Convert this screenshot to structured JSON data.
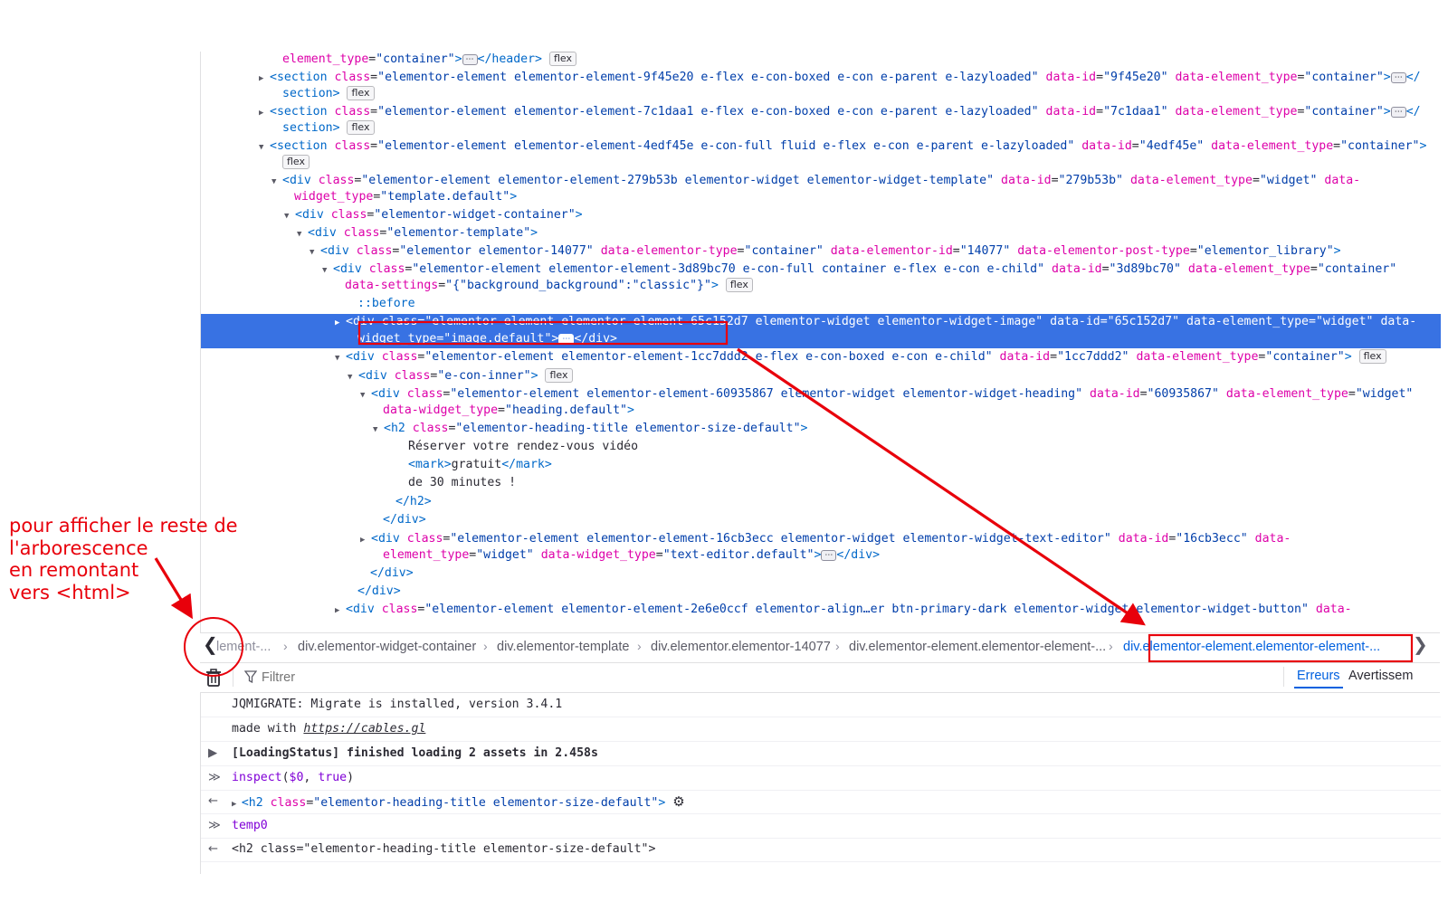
{
  "tree": [
    {
      "ind": 92,
      "tw": "",
      "parts": [
        [
          "an",
          "element_type"
        ],
        [
          "tx",
          "="
        ],
        [
          "av",
          "\"container\""
        ],
        [
          "tg",
          ">"
        ],
        [
          "dots",
          "⋯"
        ],
        [
          "tg",
          "</header>"
        ],
        [
          "sp",
          " "
        ],
        [
          "badge",
          "flex"
        ]
      ]
    },
    {
      "ind": 78,
      "tw": "▶",
      "parts": [
        [
          "tg",
          "<section "
        ],
        [
          "an",
          "class"
        ],
        [
          "tx",
          "="
        ],
        [
          "av",
          "\"elementor-element elementor-element-9f45e20 e-flex e-con-boxed e-con e-parent e-lazyloaded\""
        ],
        [
          "sp",
          " "
        ],
        [
          "an",
          "data-id"
        ],
        [
          "tx",
          "="
        ],
        [
          "av",
          "\"9f45e20\""
        ],
        [
          "sp",
          " "
        ],
        [
          "an",
          "data-element_type"
        ],
        [
          "tx",
          "="
        ],
        [
          "av",
          "\"container\""
        ],
        [
          "tg",
          ">"
        ],
        [
          "dots",
          "⋯"
        ],
        [
          "tg",
          "</"
        ]
      ]
    },
    {
      "ind": 92,
      "tw": "",
      "parts": [
        [
          "tg",
          "section>"
        ],
        [
          "sp",
          " "
        ],
        [
          "badge",
          "flex"
        ]
      ]
    },
    {
      "ind": 78,
      "tw": "▶",
      "parts": [
        [
          "tg",
          "<section "
        ],
        [
          "an",
          "class"
        ],
        [
          "tx",
          "="
        ],
        [
          "av",
          "\"elementor-element elementor-element-7c1daa1 e-flex e-con-boxed e-con e-parent e-lazyloaded\""
        ],
        [
          "sp",
          " "
        ],
        [
          "an",
          "data-id"
        ],
        [
          "tx",
          "="
        ],
        [
          "av",
          "\"7c1daa1\""
        ],
        [
          "sp",
          " "
        ],
        [
          "an",
          "data-element_type"
        ],
        [
          "tx",
          "="
        ],
        [
          "av",
          "\"container\""
        ],
        [
          "tg",
          ">"
        ],
        [
          "dots",
          "⋯"
        ],
        [
          "tg",
          "</"
        ]
      ]
    },
    {
      "ind": 92,
      "tw": "",
      "parts": [
        [
          "tg",
          "section>"
        ],
        [
          "sp",
          " "
        ],
        [
          "badge",
          "flex"
        ]
      ]
    },
    {
      "ind": 78,
      "tw": "▼",
      "parts": [
        [
          "tg",
          "<section "
        ],
        [
          "an",
          "class"
        ],
        [
          "tx",
          "="
        ],
        [
          "av",
          "\"elementor-element elementor-element-4edf45e e-con-full fluid e-flex e-con e-parent e-lazyloaded\""
        ],
        [
          "sp",
          " "
        ],
        [
          "an",
          "data-id"
        ],
        [
          "tx",
          "="
        ],
        [
          "av",
          "\"4edf45e\""
        ],
        [
          "sp",
          " "
        ],
        [
          "an",
          "data-element_type"
        ],
        [
          "tx",
          "="
        ],
        [
          "av",
          "\"container\""
        ],
        [
          "tg",
          ">"
        ]
      ]
    },
    {
      "ind": 92,
      "tw": "",
      "parts": [
        [
          "badge",
          "flex"
        ]
      ]
    },
    {
      "ind": 92,
      "tw": "▼",
      "parts": [
        [
          "tg",
          "<div "
        ],
        [
          "an",
          "class"
        ],
        [
          "tx",
          "="
        ],
        [
          "av",
          "\"elementor-element elementor-element-279b53b elementor-widget elementor-widget-template\""
        ],
        [
          "sp",
          " "
        ],
        [
          "an",
          "data-id"
        ],
        [
          "tx",
          "="
        ],
        [
          "av",
          "\"279b53b\""
        ],
        [
          "sp",
          " "
        ],
        [
          "an",
          "data-element_type"
        ],
        [
          "tx",
          "="
        ],
        [
          "av",
          "\"widget\""
        ],
        [
          "sp",
          " "
        ],
        [
          "an",
          "data-"
        ]
      ]
    },
    {
      "ind": 105,
      "tw": "",
      "parts": [
        [
          "an",
          "widget_type"
        ],
        [
          "tx",
          "="
        ],
        [
          "av",
          "\"template.default\""
        ],
        [
          "tg",
          ">"
        ]
      ]
    },
    {
      "ind": 106,
      "tw": "▼",
      "parts": [
        [
          "tg",
          "<div "
        ],
        [
          "an",
          "class"
        ],
        [
          "tx",
          "="
        ],
        [
          "av",
          "\"elementor-widget-container\""
        ],
        [
          "tg",
          ">"
        ]
      ]
    },
    {
      "ind": 120,
      "tw": "▼",
      "parts": [
        [
          "tg",
          "<div "
        ],
        [
          "an",
          "class"
        ],
        [
          "tx",
          "="
        ],
        [
          "av",
          "\"elementor-template\""
        ],
        [
          "tg",
          ">"
        ]
      ]
    },
    {
      "ind": 134,
      "tw": "▼",
      "parts": [
        [
          "tg",
          "<div "
        ],
        [
          "an",
          "class"
        ],
        [
          "tx",
          "="
        ],
        [
          "av",
          "\"elementor elementor-14077\""
        ],
        [
          "sp",
          " "
        ],
        [
          "an",
          "data-elementor-type"
        ],
        [
          "tx",
          "="
        ],
        [
          "av",
          "\"container\""
        ],
        [
          "sp",
          " "
        ],
        [
          "an",
          "data-elementor-id"
        ],
        [
          "tx",
          "="
        ],
        [
          "av",
          "\"14077\""
        ],
        [
          "sp",
          " "
        ],
        [
          "an",
          "data-elementor-post-type"
        ],
        [
          "tx",
          "="
        ],
        [
          "av",
          "\"elementor_library\""
        ],
        [
          "tg",
          ">"
        ]
      ]
    },
    {
      "ind": 148,
      "tw": "▼",
      "parts": [
        [
          "tg",
          "<div "
        ],
        [
          "an",
          "class"
        ],
        [
          "tx",
          "="
        ],
        [
          "av",
          "\"elementor-element elementor-element-3d89bc70 e-con-full container e-flex e-con e-child\""
        ],
        [
          "sp",
          " "
        ],
        [
          "an",
          "data-id"
        ],
        [
          "tx",
          "="
        ],
        [
          "av",
          "\"3d89bc70\""
        ],
        [
          "sp",
          " "
        ],
        [
          "an",
          "data-element_type"
        ],
        [
          "tx",
          "="
        ],
        [
          "av",
          "\"container\""
        ]
      ]
    },
    {
      "ind": 161,
      "tw": "",
      "parts": [
        [
          "an",
          "data-settings"
        ],
        [
          "tx",
          "="
        ],
        [
          "av",
          "\"{\"background_background\":\"classic\"}\""
        ],
        [
          "tg",
          ">"
        ],
        [
          "sp",
          " "
        ],
        [
          "badge",
          "flex"
        ]
      ]
    },
    {
      "ind": 175,
      "tw": "",
      "parts": [
        [
          "ps",
          "::before"
        ]
      ]
    },
    {
      "ind": 162,
      "tw": "▶",
      "sel": true,
      "parts": [
        [
          "tg",
          "<div "
        ],
        [
          "an",
          "class"
        ],
        [
          "tx",
          "="
        ],
        [
          "av",
          "\"elementor-element elementor-element-65c152d7 elementor-widget elementor-widget-image\""
        ],
        [
          "sp",
          " "
        ],
        [
          "an",
          "data-id"
        ],
        [
          "tx",
          "="
        ],
        [
          "av",
          "\"65c152d7\""
        ],
        [
          "sp",
          " "
        ],
        [
          "an",
          "data-element_type"
        ],
        [
          "tx",
          "="
        ],
        [
          "av",
          "\"widget\""
        ],
        [
          "sp",
          " "
        ],
        [
          "an",
          "data-"
        ]
      ]
    },
    {
      "ind": 175,
      "tw": "",
      "sel": true,
      "parts": [
        [
          "an",
          "widget_type"
        ],
        [
          "tx",
          "="
        ],
        [
          "av",
          "\"image.default\""
        ],
        [
          "tg",
          ">"
        ],
        [
          "dots",
          "⋯"
        ],
        [
          "tg",
          "</div>"
        ]
      ]
    },
    {
      "ind": 162,
      "tw": "▼",
      "parts": [
        [
          "tg",
          "<div "
        ],
        [
          "an",
          "class"
        ],
        [
          "tx",
          "="
        ],
        [
          "av",
          "\"elementor-element elementor-element-1cc7ddd2 e-flex e-con-boxed e-con e-child\""
        ],
        [
          "sp",
          " "
        ],
        [
          "an",
          "data-id"
        ],
        [
          "tx",
          "="
        ],
        [
          "av",
          "\"1cc7ddd2\""
        ],
        [
          "sp",
          " "
        ],
        [
          "an",
          "data-element_type"
        ],
        [
          "tx",
          "="
        ],
        [
          "av",
          "\"container\""
        ],
        [
          "tg",
          ">"
        ],
        [
          "sp",
          " "
        ],
        [
          "badge",
          "flex"
        ]
      ]
    },
    {
      "ind": 176,
      "tw": "▼",
      "parts": [
        [
          "tg",
          "<div "
        ],
        [
          "an",
          "class"
        ],
        [
          "tx",
          "="
        ],
        [
          "av",
          "\"e-con-inner\""
        ],
        [
          "tg",
          ">"
        ],
        [
          "sp",
          " "
        ],
        [
          "badge",
          "flex"
        ]
      ]
    },
    {
      "ind": 190,
      "tw": "▼",
      "parts": [
        [
          "tg",
          "<div "
        ],
        [
          "an",
          "class"
        ],
        [
          "tx",
          "="
        ],
        [
          "av",
          "\"elementor-element elementor-element-60935867 elementor-widget elementor-widget-heading\""
        ],
        [
          "sp",
          " "
        ],
        [
          "an",
          "data-id"
        ],
        [
          "tx",
          "="
        ],
        [
          "av",
          "\"60935867\""
        ],
        [
          "sp",
          " "
        ],
        [
          "an",
          "data-element_type"
        ],
        [
          "tx",
          "="
        ],
        [
          "av",
          "\"widget\""
        ]
      ]
    },
    {
      "ind": 203,
      "tw": "",
      "parts": [
        [
          "an",
          "data-widget_type"
        ],
        [
          "tx",
          "="
        ],
        [
          "av",
          "\"heading.default\""
        ],
        [
          "tg",
          ">"
        ]
      ]
    },
    {
      "ind": 204,
      "tw": "▼",
      "parts": [
        [
          "tg",
          "<h2 "
        ],
        [
          "an",
          "class"
        ],
        [
          "tx",
          "="
        ],
        [
          "av",
          "\"elementor-heading-title elementor-size-default\""
        ],
        [
          "tg",
          ">"
        ]
      ]
    },
    {
      "ind": 231,
      "tw": "",
      "parts": [
        [
          "tx",
          "Réserver votre rendez-vous vidéo"
        ]
      ]
    },
    {
      "ind": 231,
      "tw": "",
      "parts": [
        [
          "tg",
          "<mark>"
        ],
        [
          "tx",
          "gratuit"
        ],
        [
          "tg",
          "</mark>"
        ]
      ]
    },
    {
      "ind": 231,
      "tw": "",
      "parts": [
        [
          "tx",
          "de 30 minutes !"
        ]
      ]
    },
    {
      "ind": 217,
      "tw": "",
      "parts": [
        [
          "tg",
          "</h2>"
        ]
      ]
    },
    {
      "ind": 203,
      "tw": "",
      "parts": [
        [
          "tg",
          "</div>"
        ]
      ]
    },
    {
      "ind": 190,
      "tw": "▶",
      "parts": [
        [
          "tg",
          "<div "
        ],
        [
          "an",
          "class"
        ],
        [
          "tx",
          "="
        ],
        [
          "av",
          "\"elementor-element elementor-element-16cb3ecc elementor-widget elementor-widget-text-editor\""
        ],
        [
          "sp",
          " "
        ],
        [
          "an",
          "data-id"
        ],
        [
          "tx",
          "="
        ],
        [
          "av",
          "\"16cb3ecc\""
        ],
        [
          "sp",
          " "
        ],
        [
          "an",
          "data-"
        ]
      ]
    },
    {
      "ind": 203,
      "tw": "",
      "parts": [
        [
          "an",
          "element_type"
        ],
        [
          "tx",
          "="
        ],
        [
          "av",
          "\"widget\""
        ],
        [
          "sp",
          " "
        ],
        [
          "an",
          "data-widget_type"
        ],
        [
          "tx",
          "="
        ],
        [
          "av",
          "\"text-editor.default\""
        ],
        [
          "tg",
          ">"
        ],
        [
          "dots",
          "⋯"
        ],
        [
          "tg",
          "</div>"
        ]
      ]
    },
    {
      "ind": 189,
      "tw": "",
      "parts": [
        [
          "tg",
          "</div>"
        ]
      ]
    },
    {
      "ind": 175,
      "tw": "",
      "parts": [
        [
          "tg",
          "</div>"
        ]
      ]
    },
    {
      "ind": 162,
      "tw": "▶",
      "parts": [
        [
          "tg",
          "<div "
        ],
        [
          "an",
          "class"
        ],
        [
          "tx",
          "="
        ],
        [
          "av",
          "\"elementor-element elementor-element-2e6e0ccf elementor-align…er btn-primary-dark elementor-widget elementor-widget-button\""
        ],
        [
          "sp",
          " "
        ],
        [
          "an",
          "data-"
        ]
      ]
    }
  ],
  "breadcrumbs": [
    {
      "text": "lement-..."
    },
    {
      "text": "div.elementor-widget-container"
    },
    {
      "text": "div.elementor-template"
    },
    {
      "text": "div.elementor.elementor-14077"
    },
    {
      "text": "div.elementor-element.elementor-element-..."
    },
    {
      "text": "div.elementor-element.elementor-element-...",
      "active": true
    }
  ],
  "console": {
    "filter_placeholder": "Filtrer",
    "tab_errors": "Erreurs",
    "tab_warnings": "Avertissem",
    "lines": [
      {
        "gutter": "",
        "parts": [
          [
            "tx",
            "JQMIGRATE: Migrate is installed, version 3.4.1"
          ]
        ]
      },
      {
        "gutter": "",
        "parts": [
          [
            "tx",
            "made with "
          ],
          [
            "link",
            "https://cables.gl"
          ]
        ]
      },
      {
        "gutter": "▶",
        "parts": [
          [
            "bold",
            "[LoadingStatus] finished loading 2 assets in 2.458s"
          ]
        ]
      },
      {
        "gutter": "≫",
        "parts": [
          [
            "kw",
            "inspect"
          ],
          [
            "tx",
            "("
          ],
          [
            "kw",
            "$0"
          ],
          [
            "tx",
            ", "
          ],
          [
            "kw",
            "true"
          ],
          [
            "tx",
            ")"
          ]
        ]
      },
      {
        "gutter": "←",
        "parts": [
          [
            "tw",
            "▶ "
          ],
          [
            "tg",
            "<h2 "
          ],
          [
            "an",
            "class"
          ],
          [
            "tx",
            "="
          ],
          [
            "av",
            "\"elementor-heading-title elementor-size-default\""
          ],
          [
            "tg",
            ">"
          ],
          [
            "tx",
            " "
          ],
          [
            "gear",
            "⚙"
          ]
        ]
      },
      {
        "gutter": "≫",
        "parts": [
          [
            "kw",
            "temp0"
          ]
        ]
      },
      {
        "gutter": "←",
        "parts": [
          [
            "tx",
            "<h2 class=\"elementor-heading-title elementor-size-default\">"
          ]
        ]
      }
    ]
  },
  "annotation": {
    "lines": [
      "pour afficher le reste de",
      "l'arborescence",
      "en remontant",
      "vers <html>"
    ],
    "color": "#e8000b"
  },
  "colors": {
    "selection": "#3872e3",
    "tag": "#0068c9",
    "attr_name": "#dd00a9",
    "attr_value": "#003eaa",
    "annotation_red": "#e8000b",
    "active_tab": "#0060df"
  }
}
